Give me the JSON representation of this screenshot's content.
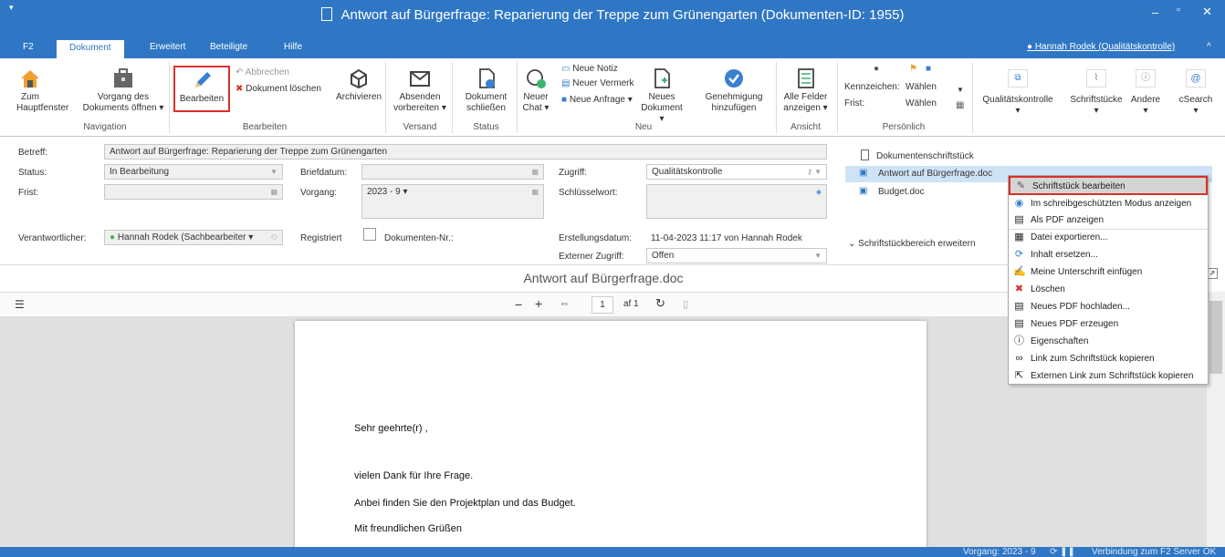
{
  "window": {
    "title": "Antwort auf Bürgerfrage: Reparierung der Treppe zum Grünengarten (Dokumenten-ID: 1955)"
  },
  "tabs": [
    "F2",
    "Dokument",
    "Erweitert",
    "Beteiligte",
    "Hilfe"
  ],
  "user": "Hannah Rodek (Qualitätskontrolle)",
  "ribbon": {
    "zum_hauptfenster": [
      "Zum",
      "Hauptfenster"
    ],
    "vorgang": [
      "Vorgang des",
      "Dokuments öffnen ▾"
    ],
    "bearbeiten": "Bearbeiten",
    "abbrechen": "Abbrechen",
    "dok_loeschen": "Dokument löschen",
    "archivieren": "Archivieren",
    "absenden": [
      "Absenden",
      "vorbereiten ▾"
    ],
    "schliessen": [
      "Dokument",
      "schließen"
    ],
    "neuer_chat": [
      "Neuer",
      "Chat ▾"
    ],
    "neue_notiz": "Neue Notiz",
    "neuer_vermerk": "Neuer Vermerk",
    "neue_anfrage": "Neue Anfrage ▾",
    "neues_dok": [
      "Neues",
      "Dokument ▾"
    ],
    "genehmigung": [
      "Genehmigung",
      "hinzufügen"
    ],
    "alle_felder": [
      "Alle Felder",
      "anzeigen ▾"
    ],
    "kennzeichen": "Kennzeichen:",
    "waehlen": "Wählen",
    "frist": "Frist:",
    "qualitaet": "Qualitätskontrolle",
    "schriftstuecke": "Schriftstücke",
    "andere": "Andere",
    "csearch": "cSearch",
    "groups": {
      "navigation": "Navigation",
      "bearbeiten": "Bearbeiten",
      "versand": "Versand",
      "status": "Status",
      "neu": "Neu",
      "ansicht": "Ansicht",
      "persoenlich": "Persönlich"
    }
  },
  "form": {
    "betreff_label": "Betreff:",
    "betreff": "Antwort auf Bürgerfrage: Reparierung der Treppe zum Grünengarten",
    "status_label": "Status:",
    "status": "In Bearbeitung",
    "frist_label": "Frist:",
    "verantwortlicher_label": "Verantwortlicher:",
    "verantwortlicher": "Hannah Rodek (Sachbearbeiter ▾",
    "briefdatum_label": "Briefdatum:",
    "vorgang_label": "Vorgang:",
    "vorgang": "2023 - 9 ▾",
    "registriert_label": "Registriert",
    "dokumenten_nr_label": "Dokumenten-Nr.:",
    "zugriff_label": "Zugriff:",
    "zugriff": "Qualitätskontrolle",
    "schluesselwort_label": "Schlüsselwort:",
    "erstellungsdatum_label": "Erstellungsdatum:",
    "erstellungsdatum": "11-04-2023 11:17  von  Hannah Rodek",
    "externer_zugriff_label": "Externer Zugriff:",
    "externer_zugriff": "Offen"
  },
  "files": {
    "header": "Dokumentenschriftstück",
    "items": [
      "Antwort auf Bürgerfrage.doc",
      "Budget.doc"
    ],
    "expand": "Schriftstückbereich erweitern"
  },
  "viewer": {
    "doc_title": "Antwort auf Bürgerfrage.doc",
    "page": "1",
    "of": "af 1"
  },
  "letter": [
    "Sehr geehrte(r) ,",
    "vielen Dank für Ihre Frage.",
    "Anbei finden Sie den Projektplan und das Budget.",
    "Mit freundlichen Grüßen"
  ],
  "context_menu": [
    {
      "label": "Schriftstück bearbeiten",
      "icon": "pencil-icon"
    },
    {
      "label": "Im schreibgeschützten Modus anzeigen",
      "icon": "eye-icon"
    },
    {
      "label": "Als PDF anzeigen",
      "icon": "pdf-icon"
    },
    {
      "label": "Datei exportieren...",
      "icon": "export-icon"
    },
    {
      "label": "Inhalt ersetzen...",
      "icon": "replace-icon"
    },
    {
      "label": "Meine Unterschrift einfügen",
      "icon": "signature-icon"
    },
    {
      "label": "Löschen",
      "icon": "delete-icon"
    },
    {
      "label": "Neues PDF hochladen...",
      "icon": "upload-pdf-icon"
    },
    {
      "label": "Neues PDF erzeugen",
      "icon": "create-pdf-icon"
    },
    {
      "label": "Eigenschaften",
      "icon": "info-icon"
    },
    {
      "label": "Link zum Schriftstück kopieren",
      "icon": "link-icon"
    },
    {
      "label": "Externen Link zum Schriftstück kopieren",
      "icon": "external-link-icon"
    }
  ],
  "status": {
    "vorgang": "Vorgang: 2023 - 9",
    "verbindung": "Verbindung zum F2 Server OK"
  },
  "colors": {
    "accent": "#2f77c4",
    "highlight": "#d9302a"
  }
}
